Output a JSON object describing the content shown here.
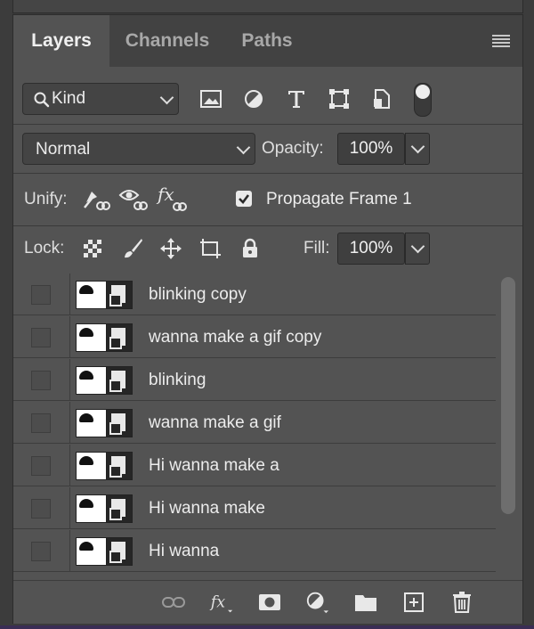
{
  "tabs": [
    {
      "label": "Layers",
      "active": true
    },
    {
      "label": "Channels",
      "active": false
    },
    {
      "label": "Paths",
      "active": false
    }
  ],
  "filter": {
    "kind_label": "Kind",
    "icons": [
      "image-filter-icon",
      "adjustment-filter-icon",
      "type-filter-icon",
      "shape-filter-icon",
      "smart-object-filter-icon",
      "filter-toggle"
    ]
  },
  "blend": {
    "mode": "Normal",
    "opacity_label": "Opacity:",
    "opacity_value": "100%"
  },
  "unify": {
    "label": "Unify:",
    "propagate_label": "Propagate Frame 1",
    "propagate_checked": true
  },
  "lock": {
    "label": "Lock:",
    "fill_label": "Fill:",
    "fill_value": "100%"
  },
  "layers": [
    {
      "name": "blinking copy"
    },
    {
      "name": "wanna make a gif copy"
    },
    {
      "name": "blinking"
    },
    {
      "name": "wanna make a gif"
    },
    {
      "name": "Hi wanna make a"
    },
    {
      "name": "Hi wanna make"
    },
    {
      "name": "Hi wanna"
    }
  ],
  "footer_icons": [
    "link-layers-icon",
    "fx-icon",
    "add-mask-icon",
    "adjustment-layer-icon",
    "new-group-icon",
    "new-layer-icon",
    "delete-icon"
  ]
}
